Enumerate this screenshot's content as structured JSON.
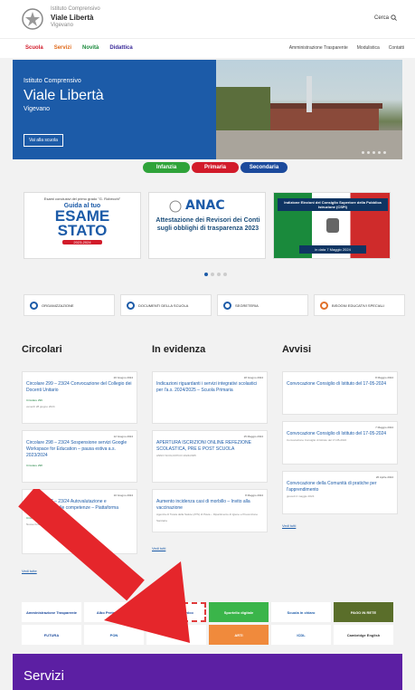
{
  "header": {
    "subtitle": "Istituto Comprensivo",
    "name": "Viale Libertà",
    "city": "Vigevano",
    "search": "Cerca"
  },
  "nav": {
    "left": [
      {
        "label": "Scuola",
        "color": "#d21b2a"
      },
      {
        "label": "Servizi",
        "color": "#e06a1a"
      },
      {
        "label": "Novità",
        "color": "#1a8a3c"
      },
      {
        "label": "Didattica",
        "color": "#3a2a99"
      }
    ],
    "right": [
      "Amministrazione Trasparente",
      "Modulistica",
      "Contatti"
    ]
  },
  "hero": {
    "line1": "Istituto Comprensivo",
    "line2": "Viale Libertà",
    "line3": "Vigevano",
    "button": "Vai alla scuola"
  },
  "levels": [
    {
      "label": "Infanzia",
      "color": "#2fa33a"
    },
    {
      "label": "Primaria",
      "color": "#d21b2a"
    },
    {
      "label": "Secondaria",
      "color": "#1c4a9c"
    }
  ],
  "cards": {
    "c1_top": "Esami conclusivi del primo grado \"G. Robecchi\"",
    "c1_mid": "Guida al tuo",
    "c1_big1": "ESAME",
    "c1_big2": "STATO",
    "c1_year": "2023-2024",
    "c2_logo": "ANAC",
    "c2_text": "Attestazione dei Revisori dei Conti sugli obblighi di trasparenza 2023",
    "c3_head": "Indizione Elezioni del Consiglio Superiore della Pubblica Istruzione (CSPI)",
    "c3_date": "in data 7 Maggio 2024"
  },
  "shortcuts": [
    "ORGANIZZAZIONE",
    "DOCUMENTI DELLA SCUOLA",
    "SEGRETERIA",
    "BISOGNI EDUCATIVI SPECIALI"
  ],
  "columns": {
    "circolari": {
      "title": "Circolari",
      "items": [
        {
          "date": "20 Giugno 2024",
          "text": "Circolare 299 – 23/24 Convocazione del Collegio dei Docenti Unitario",
          "tag": "Circolare 299",
          "meta": "venerdì 28 giugno 2024"
        },
        {
          "date": "12 Giugno 2024",
          "text": "Circolare 298 – 23/24 Sospensione servizi Google Workspace for Education – pausa estiva a.s. 2023/2024",
          "tag": "Circolare 298",
          "meta": ""
        },
        {
          "date": "10 Giugno 2024",
          "text": "Circolare 297 – 23/24 Autovalutazione e Certificazione delle competenze – Piattaforma",
          "tag": "Circolare 297",
          "meta": "Nuove funzionalità per giugno 2024"
        }
      ],
      "all": "Vedi tutte"
    },
    "evidenza": {
      "title": "In evidenza",
      "items": [
        {
          "date": "18 Giugno 2024",
          "text": "Indicazioni riguardanti i servizi integrativi scolastici per l'a.s. 2024/2025 – Scuola Primaria",
          "meta": ""
        },
        {
          "date": "15 Maggio 2024",
          "text": "APERTURA ISCRIZIONI ONLINE REFEZIONE SCOLASTICA, PRE E POST SCUOLA",
          "meta": "ANNO SCOLASTICO 2024/2025"
        },
        {
          "date": "8 Maggio 2024",
          "text": "Aumento incidenza casi di morbillo – Invito alla vaccinazione",
          "meta": "Agenzia di Tutela della Salute (ATS) di Pavia – Dipartimento di Igiene e Prevenzione Sanitaria"
        }
      ],
      "all": "Vedi tutti"
    },
    "avvisi": {
      "title": "Avvisi",
      "items": [
        {
          "date": "8 Maggio 2024",
          "text": "Convocazione Consiglio di Istituto del 17-05-2024",
          "meta": ""
        },
        {
          "date": "7 Maggio 2024",
          "text": "Convocazione Consiglio di Istituto del 17-05-2024",
          "meta": "Convocazione Consiglio di Istituto del 17-05-2024"
        },
        {
          "date": "26 Aprile 2024",
          "text": "Convocazione della Comunità di pratiche per l'apprendimento",
          "meta": "giovedì 2 maggio 2024"
        }
      ],
      "all": "Vedi tutti"
    }
  },
  "banners": {
    "row1": [
      {
        "label": "Amministrazione Trasparente",
        "bg": "#ffffff",
        "fg": "#1c4a9c"
      },
      {
        "label": "Albo Pretorio online",
        "bg": "#ffffff",
        "fg": "#1c4a9c"
      },
      {
        "label": "Registro elettronico",
        "bg": "#ffffff",
        "fg": "#1c4a9c"
      },
      {
        "label": "Sportello digitale",
        "bg": "#3ab54a",
        "fg": "#ffffff"
      },
      {
        "label": "Scuola in chiaro",
        "bg": "#ffffff",
        "fg": "#1c5ba8"
      },
      {
        "label": "PAGO IN RETE",
        "bg": "#5a6e2a",
        "fg": "#ffffff"
      }
    ],
    "row2": [
      {
        "label": "FUTURA",
        "bg": "#ffffff",
        "fg": "#1c4a9c"
      },
      {
        "label": "PON",
        "bg": "#ffffff",
        "fg": "#1c5ba8"
      },
      {
        "label": "ITALIA 2030",
        "bg": "#ffffff",
        "fg": "#1c4a9c"
      },
      {
        "label": "ARTI",
        "bg": "#f08a3c",
        "fg": "#ffffff"
      },
      {
        "label": "ICDL",
        "bg": "#ffffff",
        "fg": "#1c5ba8"
      },
      {
        "label": "Cambridge English",
        "bg": "#ffffff",
        "fg": "#333333"
      }
    ]
  },
  "services": "Servizi"
}
